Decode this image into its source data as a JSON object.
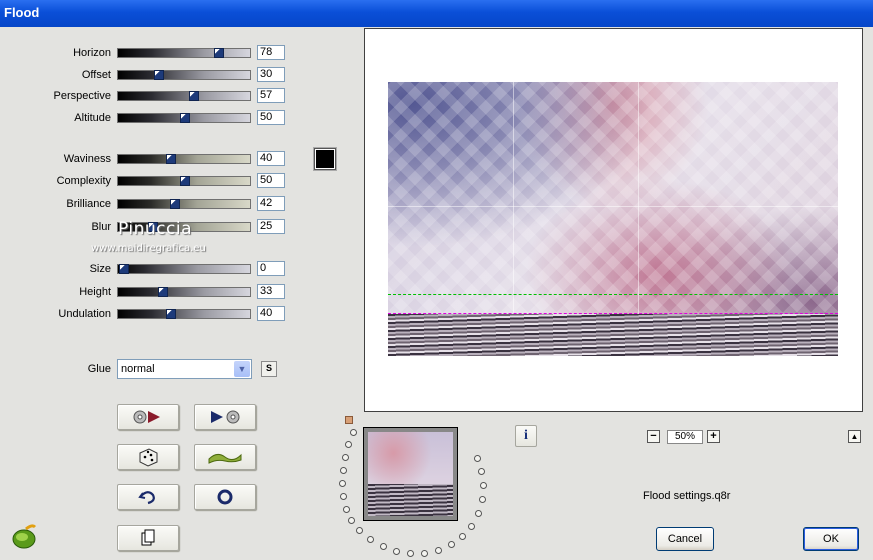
{
  "window": {
    "title": "Flood"
  },
  "sliders_group1": [
    {
      "label": "Horizon",
      "value": "78",
      "pct": 78
    },
    {
      "label": "Offset",
      "value": "30",
      "pct": 30
    },
    {
      "label": "Perspective",
      "value": "57",
      "pct": 57
    },
    {
      "label": "Altitude",
      "value": "50",
      "pct": 50
    }
  ],
  "sliders_group2": [
    {
      "label": "Waviness",
      "value": "40",
      "pct": 40
    },
    {
      "label": "Complexity",
      "value": "50",
      "pct": 50
    },
    {
      "label": "Brilliance",
      "value": "42",
      "pct": 42
    },
    {
      "label": "Blur",
      "value": "25",
      "pct": 25
    }
  ],
  "sliders_group3": [
    {
      "label": "Size",
      "value": "0",
      "pct": 0
    },
    {
      "label": "Height",
      "value": "33",
      "pct": 33
    },
    {
      "label": "Undulation",
      "value": "40",
      "pct": 40
    }
  ],
  "color_swatch": "#000000",
  "glue": {
    "label": "Glue",
    "value": "normal",
    "s_label": "S"
  },
  "watermark": {
    "name": "Pinuccia",
    "url": "www.maidiregrafica.eu"
  },
  "zoom": {
    "value": "50%",
    "minus": "−",
    "plus": "+"
  },
  "info_button": "i",
  "settings_file": "Flood settings.q8r",
  "buttons": {
    "cancel": "Cancel",
    "ok": "OK"
  },
  "icons": [
    "reset-to-defaults-icon",
    "play-compare-icon",
    "randomize-dice-icon",
    "wave-icon",
    "undo-icon",
    "ring-icon",
    "new-document-icon"
  ]
}
